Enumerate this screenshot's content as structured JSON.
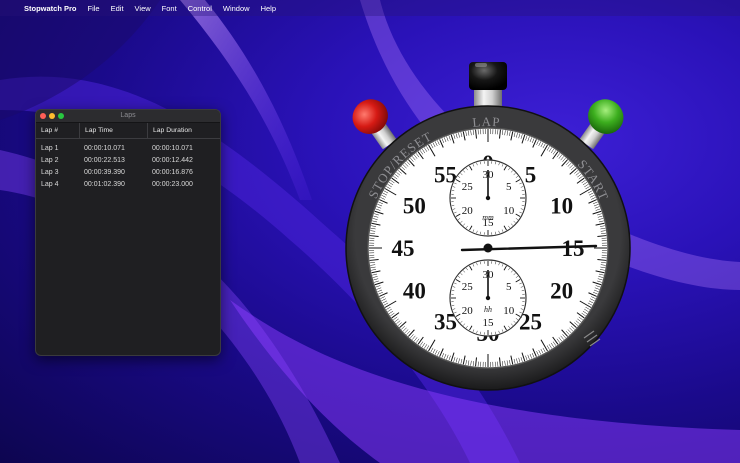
{
  "menubar": {
    "app_name": "Stopwatch Pro",
    "items": [
      "File",
      "Edit",
      "View",
      "Font",
      "Control",
      "Window",
      "Help"
    ]
  },
  "laps_window": {
    "title": "Laps",
    "columns": [
      "Lap #",
      "Lap Time",
      "Lap Duration"
    ],
    "rows": [
      [
        "Lap 1",
        "00:00:10.071",
        "00:00:10.071"
      ],
      [
        "Lap 2",
        "00:00:22.513",
        "00:00:12.442"
      ],
      [
        "Lap 3",
        "00:00:39.390",
        "00:00:16.876"
      ],
      [
        "Lap 4",
        "00:01:02.390",
        "00:00:23.000"
      ]
    ]
  },
  "stopwatch": {
    "button_labels": {
      "left": "STOP/RESET",
      "top": "LAP",
      "right": "START"
    },
    "dial_numbers": [
      "0",
      "5",
      "10",
      "15",
      "20",
      "25",
      "30",
      "35",
      "40",
      "45",
      "50",
      "55"
    ],
    "upper_subdial": {
      "numbers": [
        "30",
        "5",
        "10",
        "15",
        "20",
        "25"
      ],
      "unit": "mm"
    },
    "lower_subdial": {
      "numbers": [
        "30",
        "5",
        "10",
        "15",
        "20",
        "25"
      ],
      "unit": "hh"
    },
    "main_hand_seconds": 15,
    "upper_subdial_value": 0,
    "lower_subdial_value": 0,
    "colors": {
      "stop_button": "#d01818",
      "start_button": "#3cae1e",
      "case": "#2a2a2c",
      "face": "#ffffff"
    }
  }
}
